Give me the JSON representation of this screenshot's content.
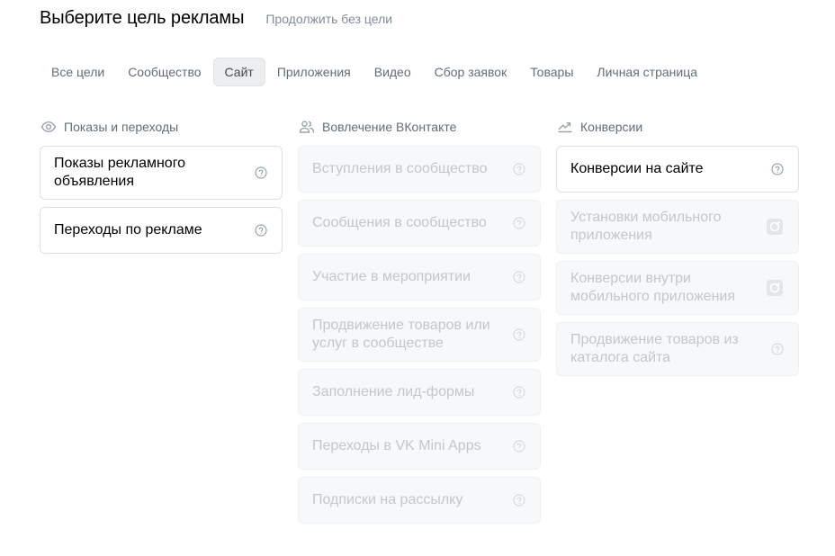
{
  "header": {
    "title": "Выберите цель рекламы",
    "skip_link": "Продолжить без цели"
  },
  "tabs": [
    {
      "label": "Все цели",
      "active": false
    },
    {
      "label": "Сообщество",
      "active": false
    },
    {
      "label": "Сайт",
      "active": true
    },
    {
      "label": "Приложения",
      "active": false
    },
    {
      "label": "Видео",
      "active": false
    },
    {
      "label": "Сбор заявок",
      "active": false
    },
    {
      "label": "Товары",
      "active": false
    },
    {
      "label": "Личная страница",
      "active": false
    }
  ],
  "columns": [
    {
      "icon": "eye-icon",
      "title": "Показы и переходы",
      "cards": [
        {
          "label": "Показы рекламного объявления",
          "enabled": true,
          "icon": "question-circle-icon"
        },
        {
          "label": "Переходы по рекламе",
          "enabled": true,
          "icon": "question-circle-icon"
        }
      ]
    },
    {
      "icon": "users-icon",
      "title": "Вовлечение ВКонтакте",
      "cards": [
        {
          "label": "Вступления в сообщество",
          "enabled": false,
          "icon": "question-circle-icon"
        },
        {
          "label": "Сообщения в сообщество",
          "enabled": false,
          "icon": "question-circle-icon"
        },
        {
          "label": "Участие в мероприятии",
          "enabled": false,
          "icon": "question-circle-icon"
        },
        {
          "label": "Продвижение товаров или услуг в сообществе",
          "enabled": false,
          "icon": "question-circle-icon"
        },
        {
          "label": "Заполнение лид-формы",
          "enabled": false,
          "icon": "question-circle-icon"
        },
        {
          "label": "Переходы в VK Mini Apps",
          "enabled": false,
          "icon": "question-circle-icon"
        },
        {
          "label": "Подписки на рассылку",
          "enabled": false,
          "icon": "question-circle-icon"
        }
      ]
    },
    {
      "icon": "trending-up-icon",
      "title": "Конверсии",
      "cards": [
        {
          "label": "Конверсии на сайте",
          "enabled": true,
          "icon": "question-circle-icon"
        },
        {
          "label": "Установки мобильного приложения",
          "enabled": false,
          "icon": "app-badge-icon"
        },
        {
          "label": "Конверсии внутри мобильного приложения",
          "enabled": false,
          "icon": "app-badge-icon"
        },
        {
          "label": "Продвижение товаров из каталога сайта",
          "enabled": false,
          "icon": "question-circle-icon"
        }
      ]
    }
  ],
  "colors": {
    "text_primary": "#000000",
    "text_secondary": "#626d7a",
    "text_disabled": "#c2c7ce",
    "border": "#dce1e6",
    "active_tab_bg": "#edeef0",
    "disabled_bg": "#f7f8fa"
  }
}
